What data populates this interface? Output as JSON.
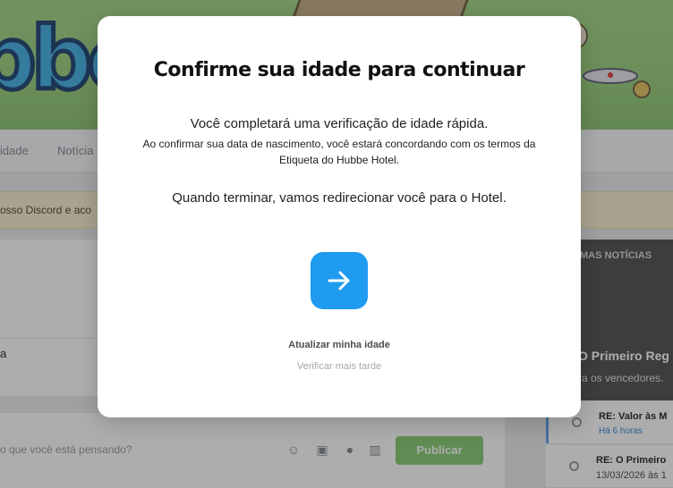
{
  "background": {
    "logo_text": "bbe",
    "nav": [
      "idade",
      "Notícia"
    ],
    "notice_text": "osso Discord e aco",
    "left_card_text": "a",
    "composer": {
      "placeholder": "o que você está pensando?",
      "publish_label": "Publicar"
    },
    "news": {
      "heading": "MAS NOTÍCIAS",
      "hero_title": "O Primeiro Reg",
      "hero_subtitle": "ra os vencedores."
    },
    "topics": [
      {
        "title": "RE: Valor às M",
        "meta": "Há 6 horas"
      },
      {
        "title": "RE: O Primeiro",
        "meta": "13/03/2026 às 1"
      }
    ]
  },
  "modal": {
    "title": "Confirme sua idade para continuar",
    "lead": "Você completará uma verificação de idade rápida.",
    "detail": "Ao confirmar sua data de nascimento, você estará concordando com os termos da Etiqueta do Hubbe Hotel.",
    "redirect": "Quando terminar, vamos redirecionar você para o Hotel.",
    "continue_icon": "arrow-right-icon",
    "update_label": "Atualizar minha idade",
    "later_label": "Verificar mais tarde",
    "accent_color": "#1f9bf0"
  }
}
